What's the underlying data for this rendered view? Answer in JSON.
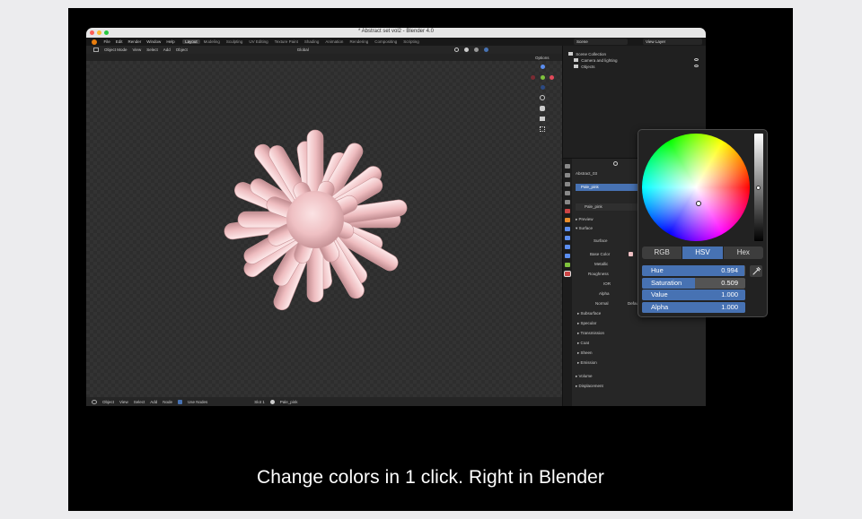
{
  "caption": "Change colors in 1 click. Right in Blender",
  "window": {
    "title": "* Abstract set vol2 - Blender 4.0",
    "menu": [
      "File",
      "Edit",
      "Render",
      "Window",
      "Help"
    ],
    "workspaces": [
      "Layout",
      "Modeling",
      "Sculpting",
      "UV Editing",
      "Texture Paint",
      "Shading",
      "Animation",
      "Rendering",
      "Compositing",
      "Scripting"
    ],
    "active_workspace": "Layout",
    "scene": "Scene",
    "view_layer": "View Layer"
  },
  "viewport": {
    "mode": "Object Mode",
    "menus": [
      "View",
      "Select",
      "Add",
      "Object"
    ],
    "transform": "Global",
    "options": "Options"
  },
  "node_status": {
    "mode": "Object",
    "menus": [
      "View",
      "Select",
      "Add",
      "Node"
    ],
    "use_nodes": "Use Nodes",
    "slot": "Slot 1",
    "material": "Pale_pink"
  },
  "outliner": {
    "root": "Scene Collection",
    "items": [
      "Camera and lighting",
      "Objects"
    ]
  },
  "properties": {
    "object": "Abstract_03",
    "material_slot": "Pale_pink",
    "material": "Pale_pink",
    "sections": [
      "Preview",
      "Surface"
    ],
    "surface_label": "Surface",
    "rows": [
      "Base Color",
      "Metallic",
      "Roughness",
      "IOR",
      "Alpha",
      "Normal"
    ],
    "normal_value": "Default",
    "subsections": [
      "Subsurface",
      "Specular",
      "Transmission",
      "Coat",
      "Sheen",
      "Emission"
    ],
    "bottom": [
      "Volume",
      "Displacement"
    ]
  },
  "color_picker": {
    "modes": [
      "RGB",
      "HSV",
      "Hex"
    ],
    "active_mode": "HSV",
    "fields": [
      {
        "label": "Hue",
        "value": "0.994",
        "fill": 0.994
      },
      {
        "label": "Saturation",
        "value": "0.509",
        "fill": 0.509
      },
      {
        "label": "Value",
        "value": "1.000",
        "fill": 1.0
      },
      {
        "label": "Alpha",
        "value": "1.000",
        "fill": 1.0
      }
    ]
  },
  "colors": {
    "accent": "#4772b3",
    "object_pink": "#f1c3c6",
    "frame": "#000000"
  }
}
